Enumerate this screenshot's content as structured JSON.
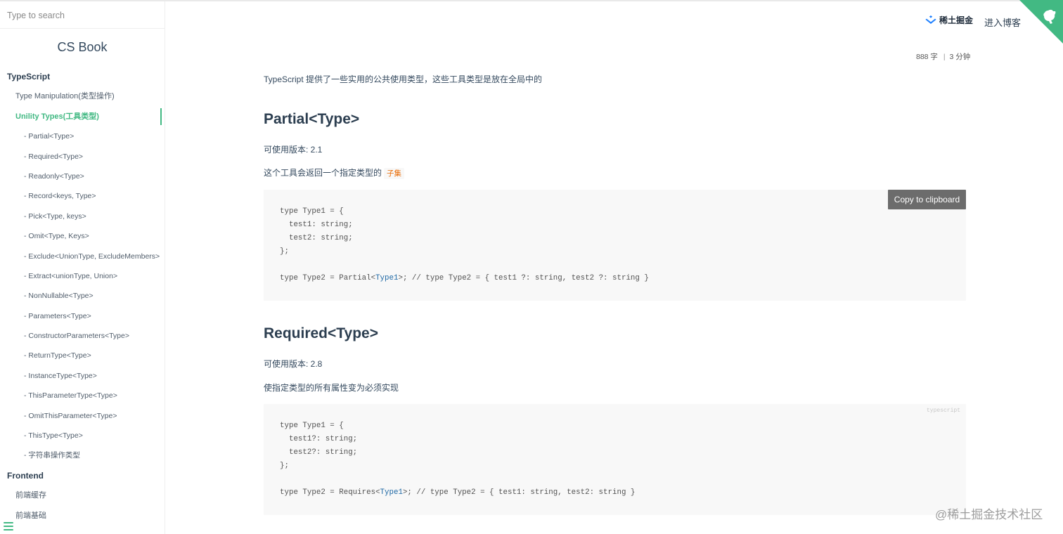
{
  "search": {
    "placeholder": "Type to search"
  },
  "sidebar": {
    "brand": "CS Book",
    "groups": [
      {
        "label": "TypeScript",
        "items": [
          {
            "label": "Type Manipulation(类型操作)"
          },
          {
            "label": "Unility Types(工具类型)",
            "active": true,
            "subitems": [
              "- Partial<Type>",
              "- Required<Type>",
              "- Readonly<Type>",
              "- Record<keys, Type>",
              "- Pick<Type, keys>",
              "- Omit<Type, Keys>",
              "- Exclude<UnionType, ExcludeMembers>",
              "- Extract<unionType, Union>",
              "- NonNullable<Type>",
              "- Parameters<Type>",
              "- ConstructorParameters<Type>",
              "- ReturnType<Type>",
              "- InstanceType<Type>",
              "- ThisParameterType<Type>",
              "- OmitThisParameter<Type>",
              "- ThisType<Type>",
              "- 字符串操作类型"
            ]
          }
        ]
      },
      {
        "label": "Frontend",
        "items": [
          {
            "label": "前端缓存"
          },
          {
            "label": "前端基础"
          }
        ]
      }
    ]
  },
  "header": {
    "juejin_label": "稀土掘金",
    "blog_link": "进入博客"
  },
  "meta": {
    "words": "888 字",
    "separator": "|",
    "minutes": "3 分钟"
  },
  "content": {
    "intro": "TypeScript 提供了一些实用的公共使用类型，这些工具类型是放在全局中的",
    "sections": [
      {
        "title": "Partial<Type>",
        "version": "可使用版本: 2.1",
        "desc": "这个工具会返回一个指定类型的",
        "inline_code": "子集",
        "code_lines": [
          "type Type1 = {",
          "  test1: string;",
          "  test2: string;",
          "};",
          "",
          "type Type2 = Partial<|Type1|>; // type Type2 = { test1 ?: string, test2 ?: string }"
        ]
      },
      {
        "title": "Required<Type>",
        "version": "可使用版本: 2.8",
        "desc": "使指定类型的所有属性变为必须实现",
        "code_lang": "typescript",
        "code_lines": [
          "type Type1 = {",
          "  test1?: string;",
          "  test2?: string;",
          "};",
          "",
          "type Type2 = Requires<|Type1|>; // type Type2 = { test1: string, test2: string }"
        ]
      }
    ],
    "copy_button": "Copy to clipboard"
  },
  "watermark": "@稀土掘金技术社区",
  "colors": {
    "accent": "#42b983",
    "heading": "#2c3e50",
    "code_bg": "#f8f8f8",
    "inline_code": "#e96900"
  }
}
